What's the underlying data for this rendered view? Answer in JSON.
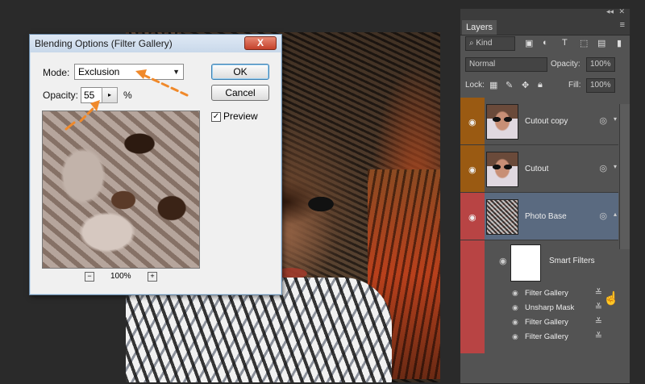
{
  "dialog": {
    "title": "Blending Options (Filter Gallery)",
    "close_label": "X",
    "mode_label": "Mode:",
    "mode_value": "Exclusion",
    "opacity_label": "Opacity:",
    "opacity_value": "55",
    "opacity_unit": "%",
    "ok_label": "OK",
    "cancel_label": "Cancel",
    "preview_label": "Preview",
    "preview_checked": true,
    "zoom_value": "100%",
    "zoom_out_label": "−",
    "zoom_in_label": "+"
  },
  "panel": {
    "tab_label": "Layers",
    "collapse_label": "◂◂",
    "close_label": "✕",
    "menu_label": "≡",
    "filter_kind": "Kind",
    "blend_mode": "Normal",
    "opacity_label": "Opacity:",
    "opacity_value": "100%",
    "lock_label": "Lock:",
    "fill_label": "Fill:",
    "fill_value": "100%",
    "layers": [
      {
        "name": "Cutout copy",
        "color": "#9a5a12"
      },
      {
        "name": "Cutout",
        "color": "#9a5a12"
      },
      {
        "name": "Photo Base",
        "color": "#b84444"
      }
    ],
    "smart_filters_label": "Smart Filters",
    "filters": [
      "Filter Gallery",
      "Unsharp Mask",
      "Filter Gallery",
      "Filter Gallery"
    ]
  },
  "colors": {
    "annotation": "#f0892a",
    "selected_layer": "#5a6a80"
  }
}
